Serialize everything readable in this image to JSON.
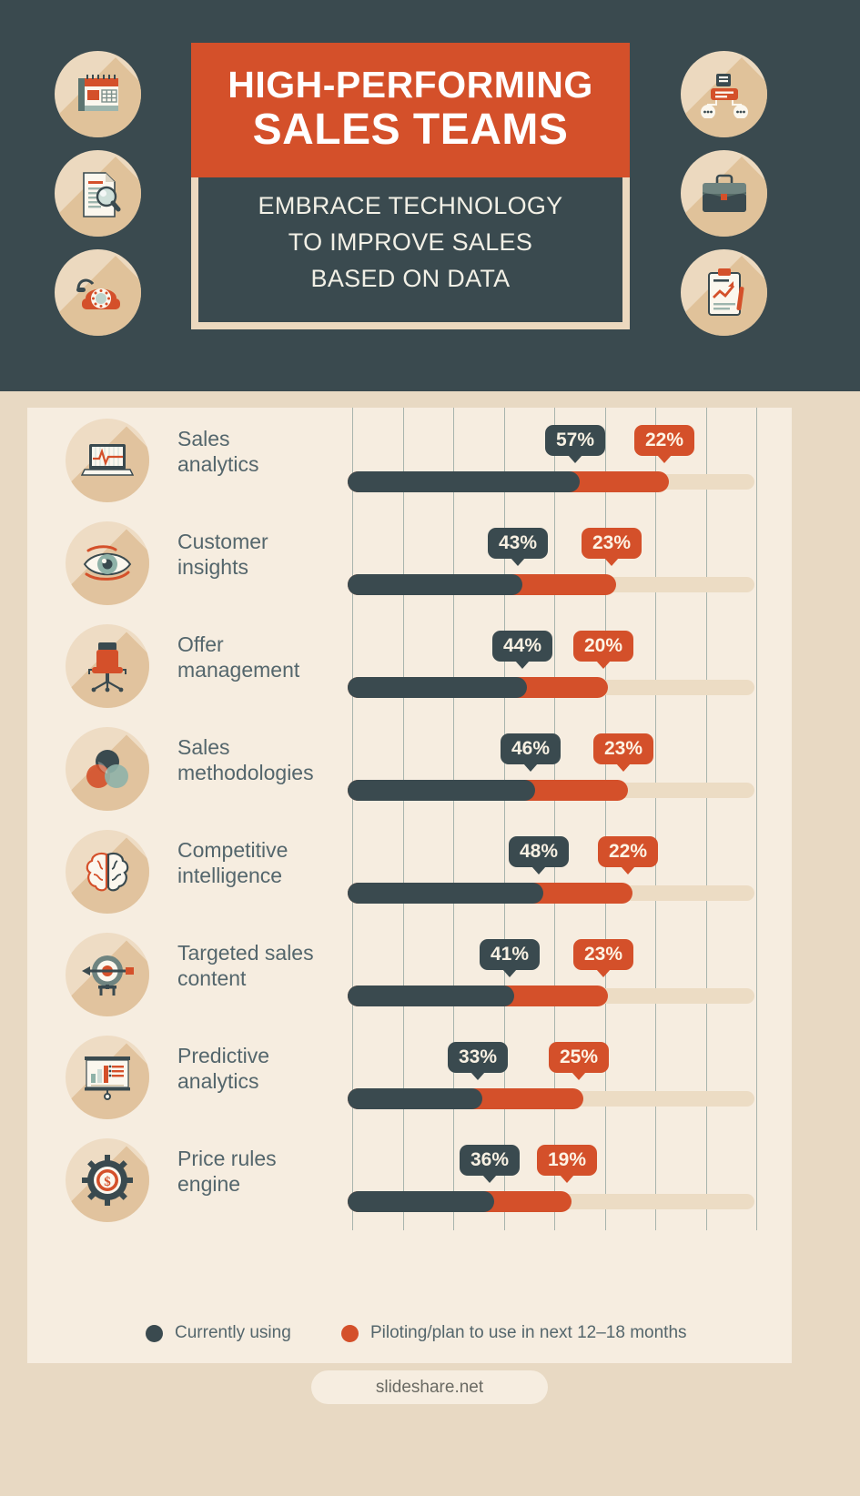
{
  "header": {
    "title_line1": "HIGH-PERFORMING",
    "title_line2": "SALES TEAMS",
    "subtitle": "EMBRACE TECHNOLOGY\nTO IMPROVE SALES\nBASED ON DATA",
    "subtitle_lines": [
      "EMBRACE TECHNOLOGY",
      "TO IMPROVE SALES",
      "BASED ON DATA"
    ],
    "left_icons": [
      "calendar-icon",
      "document-search-icon",
      "telephone-icon"
    ],
    "right_icons": [
      "org-chart-icon",
      "briefcase-icon",
      "clipboard-chart-icon"
    ]
  },
  "colors": {
    "dark": "#3a4a4f",
    "accent": "#d4502a",
    "panel": "#f6ede0",
    "page": "#e8d9c3",
    "track": "#ecdcc4",
    "icon_circle": "#eedcc4",
    "gridline": "#9aa9a3",
    "label_text": "#54666c"
  },
  "legend": {
    "items": [
      {
        "label": "Currently using",
        "color": "#3a4a4f",
        "name": "legend-currently-using"
      },
      {
        "label": "Piloting/plan to use in next 12–18 months",
        "color": "#d4502a",
        "name": "legend-piloting"
      }
    ]
  },
  "footer": {
    "source": "slideshare.net"
  },
  "chart_data": {
    "type": "bar",
    "title": "HIGH-PERFORMING SALES TEAMS",
    "subtitle": "EMBRACE TECHNOLOGY TO IMPROVE SALES BASED ON DATA",
    "orientation": "horizontal",
    "stacked": true,
    "xlabel": "",
    "ylabel": "",
    "xlim": [
      0,
      100
    ],
    "grid": true,
    "gridline_count": 9,
    "legend_position": "bottom",
    "unit": "%",
    "categories": [
      "Sales analytics",
      "Customer insights",
      "Offer management",
      "Sales methodologies",
      "Competitive intelligence",
      "Targeted sales content",
      "Predictive analytics",
      "Price rules engine"
    ],
    "category_icons": [
      "laptop-chart-icon",
      "eye-icon",
      "office-chair-icon",
      "venn-diagram-icon",
      "brain-icon",
      "target-arrow-icon",
      "presentation-board-icon",
      "gear-dollar-icon"
    ],
    "series": [
      {
        "name": "Currently using",
        "color": "#3a4a4f",
        "values": [
          57,
          43,
          44,
          46,
          48,
          41,
          33,
          36
        ]
      },
      {
        "name": "Piloting/plan to use in next 12–18 months",
        "color": "#d4502a",
        "values": [
          22,
          23,
          20,
          23,
          22,
          23,
          25,
          19
        ]
      }
    ],
    "rows": [
      {
        "label_line1": "Sales",
        "label_line2": "analytics",
        "a": 57,
        "b": 22,
        "a_text": "57%",
        "b_text": "22%"
      },
      {
        "label_line1": "Customer",
        "label_line2": "insights",
        "a": 43,
        "b": 23,
        "a_text": "43%",
        "b_text": "23%"
      },
      {
        "label_line1": "Offer",
        "label_line2": "management",
        "a": 44,
        "b": 20,
        "a_text": "44%",
        "b_text": "20%"
      },
      {
        "label_line1": "Sales",
        "label_line2": "methodologies",
        "a": 46,
        "b": 23,
        "a_text": "46%",
        "b_text": "23%"
      },
      {
        "label_line1": "Competitive",
        "label_line2": "intelligence",
        "a": 48,
        "b": 22,
        "a_text": "48%",
        "b_text": "22%"
      },
      {
        "label_line1": "Targeted sales",
        "label_line2": "content",
        "a": 41,
        "b": 23,
        "a_text": "41%",
        "b_text": "23%"
      },
      {
        "label_line1": "Predictive",
        "label_line2": "analytics",
        "a": 33,
        "b": 25,
        "a_text": "33%",
        "b_text": "25%"
      },
      {
        "label_line1": "Price rules",
        "label_line2": "engine",
        "a": 36,
        "b": 19,
        "a_text": "36%",
        "b_text": "19%"
      }
    ]
  }
}
